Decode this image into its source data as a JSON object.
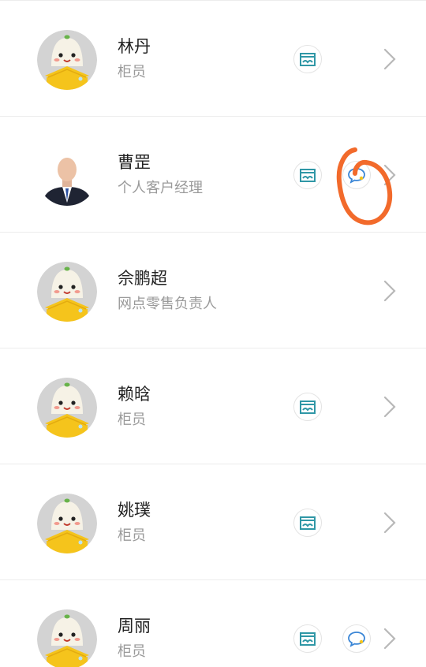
{
  "contacts": [
    {
      "name": "林丹",
      "role": "柜员",
      "avatar": "mascot-avatar",
      "store": true,
      "chat": false
    },
    {
      "name": "曹罡",
      "role": "个人客户经理",
      "avatar": "photo-avatar",
      "store": true,
      "chat": true
    },
    {
      "name": "佘鹏超",
      "role": "网点零售负责人",
      "avatar": "mascot-avatar",
      "store": false,
      "chat": false
    },
    {
      "name": "赖晗",
      "role": "柜员",
      "avatar": "mascot-avatar",
      "store": true,
      "chat": false
    },
    {
      "name": "姚璞",
      "role": "柜员",
      "avatar": "mascot-avatar",
      "store": true,
      "chat": false
    },
    {
      "name": "周丽",
      "role": "柜员",
      "avatar": "mascot-avatar",
      "store": true,
      "chat": true
    }
  ],
  "icons": {
    "store": "store-icon",
    "chat": "chat-bubble-icon",
    "chevron": "chevron-right-icon"
  },
  "colors": {
    "name_text": "#222222",
    "role_text": "#9a9a9a",
    "divider": "#ececec",
    "icon_teal": "#2f97a6",
    "chat_blue": "#3a86d6",
    "annotation": "#f26a2b",
    "mascot_yellow": "#f5c41c"
  }
}
